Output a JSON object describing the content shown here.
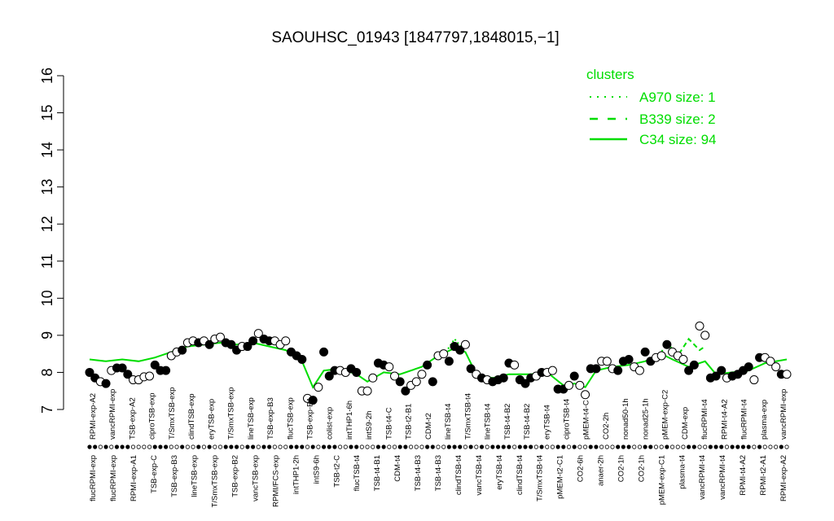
{
  "chart_data": {
    "type": "scatter",
    "title": "SAOUHSC_01943 [1847797,1848015,−1]",
    "ylim": [
      7,
      16
    ],
    "yticks": [
      7,
      8,
      9,
      10,
      11,
      12,
      13,
      14,
      15,
      16
    ],
    "grid": false,
    "legend": {
      "title": "clusters",
      "position": "top-right",
      "entries": [
        {
          "label": "A970 size: 1",
          "style": "dotted"
        },
        {
          "label": "B339 size: 2",
          "style": "dashed"
        },
        {
          "label": "C34 size: 94",
          "style": "solid"
        }
      ]
    },
    "colors": {
      "cluster_line": "#00dd00",
      "point_fill_dark": "#000000",
      "point_fill_light": "#ffffff"
    },
    "bottom_labels": [
      "flucRPMI-exp",
      "flucRPMI-exp",
      "RPMI-exp-A1",
      "TSB-exp-C",
      "TSB-exp-B3",
      "lineTSB-exp",
      "T/SmxTSB-exp",
      "TSB-exp-B2",
      "vancTSB-exp",
      "RPMI/FCS-exp",
      "intTHP1-2h",
      "intS9-6h",
      "TSB-t2-C",
      "flucTSB-t4",
      "TSB-t4-B1",
      "CDM-t4",
      "TSB-t4-B3",
      "TSB-t4-B3",
      "clindTSB-t4",
      "vancTSB-t4",
      "eryTSB-t4",
      "clindTSB-t4",
      "T/SmxTSB-t4",
      "pMEM-t2-C1",
      "CO2-6h",
      "anaer-2h",
      "CO2-1h",
      "CO2-1h",
      "pMEM-exp-C1",
      "plasma-t4",
      "vancRPMI-t4",
      "vancRPMI-t4",
      "RPMI-t4-A2",
      "RPMI-t2-A1",
      "RPMI-exp-A2"
    ],
    "top_labels": [
      "RPMI-exp-A2",
      "vancRPMI-exp",
      "TSB-exp-A2",
      "ciproTSB-exp",
      "T/SmxTSB-exp",
      "clindTSB-exp",
      "eryTSB-exp",
      "T/SmxTSB-exp",
      "lineTSB-exp",
      "TSB-exp-B3",
      "flucTSB-exp",
      "TSB-exp-B1",
      "colist-exp",
      "intTHP1-6h",
      "intS9-2h",
      "TSB-t4-C",
      "TSB-t2-B1",
      "CDM-t2",
      "lineTSB-t4",
      "T/SmxTSB-t4",
      "lineTSB-t4",
      "TSB-t4-B2",
      "TSB-t4-B2",
      "eryTSB-t4",
      "ciproTSB-t4",
      "pMEM-t4-C",
      "CO2-2h",
      "nonad50-1h",
      "nonad25-1h",
      "pMEM-exp-C2",
      "CDM-exp",
      "flucRPMI-t4",
      "RPMI-t4-A2",
      "flucRPMI-t4",
      "plasma-exp",
      "vancRPMI-exp"
    ],
    "points": [
      {
        "x": 1,
        "y": 8.0,
        "f": 1
      },
      {
        "x": 2,
        "y": 7.85,
        "f": 1
      },
      {
        "x": 3,
        "y": 7.75,
        "f": 0
      },
      {
        "x": 4,
        "y": 7.7,
        "f": 1
      },
      {
        "x": 5,
        "y": 8.05,
        "f": 0
      },
      {
        "x": 6,
        "y": 8.12,
        "f": 1
      },
      {
        "x": 7,
        "y": 8.12,
        "f": 1
      },
      {
        "x": 8,
        "y": 7.95,
        "f": 1
      },
      {
        "x": 9,
        "y": 7.8,
        "f": 0
      },
      {
        "x": 10,
        "y": 7.8,
        "f": 0
      },
      {
        "x": 11,
        "y": 7.88,
        "f": 0
      },
      {
        "x": 12,
        "y": 7.9,
        "f": 0
      },
      {
        "x": 13,
        "y": 8.2,
        "f": 1
      },
      {
        "x": 14,
        "y": 8.05,
        "f": 1
      },
      {
        "x": 15,
        "y": 8.05,
        "f": 1
      },
      {
        "x": 16,
        "y": 8.45,
        "f": 0
      },
      {
        "x": 17,
        "y": 8.55,
        "f": 0
      },
      {
        "x": 18,
        "y": 8.6,
        "f": 1
      },
      {
        "x": 19,
        "y": 8.8,
        "f": 0
      },
      {
        "x": 20,
        "y": 8.85,
        "f": 0
      },
      {
        "x": 21,
        "y": 8.8,
        "f": 1
      },
      {
        "x": 22,
        "y": 8.85,
        "f": 0
      },
      {
        "x": 23,
        "y": 8.75,
        "f": 1
      },
      {
        "x": 24,
        "y": 8.9,
        "f": 0
      },
      {
        "x": 25,
        "y": 8.95,
        "f": 0
      },
      {
        "x": 26,
        "y": 8.8,
        "f": 1
      },
      {
        "x": 27,
        "y": 8.75,
        "f": 1
      },
      {
        "x": 28,
        "y": 8.6,
        "f": 1
      },
      {
        "x": 29,
        "y": 8.7,
        "f": 0
      },
      {
        "x": 30,
        "y": 8.7,
        "f": 1
      },
      {
        "x": 31,
        "y": 8.85,
        "f": 1
      },
      {
        "x": 32,
        "y": 9.05,
        "f": 0
      },
      {
        "x": 33,
        "y": 8.9,
        "f": 1
      },
      {
        "x": 34,
        "y": 8.85,
        "f": 1
      },
      {
        "x": 35,
        "y": 8.85,
        "f": 0
      },
      {
        "x": 36,
        "y": 8.75,
        "f": 0
      },
      {
        "x": 37,
        "y": 8.85,
        "f": 0
      },
      {
        "x": 38,
        "y": 8.55,
        "f": 1
      },
      {
        "x": 39,
        "y": 8.45,
        "f": 1
      },
      {
        "x": 40,
        "y": 8.35,
        "f": 1
      },
      {
        "x": 41,
        "y": 7.3,
        "f": 0
      },
      {
        "x": 42,
        "y": 7.25,
        "f": 1
      },
      {
        "x": 43,
        "y": 7.6,
        "f": 0
      },
      {
        "x": 44,
        "y": 8.55,
        "f": 1
      },
      {
        "x": 45,
        "y": 7.9,
        "f": 1
      },
      {
        "x": 46,
        "y": 8.05,
        "f": 1
      },
      {
        "x": 47,
        "y": 8.05,
        "f": 0
      },
      {
        "x": 48,
        "y": 8.0,
        "f": 0
      },
      {
        "x": 49,
        "y": 8.1,
        "f": 1
      },
      {
        "x": 50,
        "y": 8.0,
        "f": 1
      },
      {
        "x": 51,
        "y": 7.5,
        "f": 0
      },
      {
        "x": 52,
        "y": 7.5,
        "f": 0
      },
      {
        "x": 53,
        "y": 7.85,
        "f": 0
      },
      {
        "x": 54,
        "y": 8.25,
        "f": 1
      },
      {
        "x": 55,
        "y": 8.2,
        "f": 1
      },
      {
        "x": 56,
        "y": 8.15,
        "f": 0
      },
      {
        "x": 57,
        "y": 7.9,
        "f": 0
      },
      {
        "x": 58,
        "y": 7.75,
        "f": 1
      },
      {
        "x": 59,
        "y": 7.5,
        "f": 1
      },
      {
        "x": 60,
        "y": 7.65,
        "f": 0
      },
      {
        "x": 61,
        "y": 7.75,
        "f": 0
      },
      {
        "x": 62,
        "y": 7.95,
        "f": 0
      },
      {
        "x": 63,
        "y": 8.2,
        "f": 1
      },
      {
        "x": 64,
        "y": 7.75,
        "f": 1
      },
      {
        "x": 65,
        "y": 8.45,
        "f": 0
      },
      {
        "x": 66,
        "y": 8.5,
        "f": 0
      },
      {
        "x": 67,
        "y": 8.3,
        "f": 1
      },
      {
        "x": 68,
        "y": 8.7,
        "f": 1
      },
      {
        "x": 69,
        "y": 8.6,
        "f": 1
      },
      {
        "x": 70,
        "y": 8.75,
        "f": 0
      },
      {
        "x": 71,
        "y": 8.1,
        "f": 1
      },
      {
        "x": 72,
        "y": 7.95,
        "f": 0
      },
      {
        "x": 73,
        "y": 7.85,
        "f": 1
      },
      {
        "x": 74,
        "y": 7.8,
        "f": 0
      },
      {
        "x": 75,
        "y": 7.75,
        "f": 1
      },
      {
        "x": 76,
        "y": 7.8,
        "f": 1
      },
      {
        "x": 77,
        "y": 7.85,
        "f": 1
      },
      {
        "x": 78,
        "y": 8.25,
        "f": 1
      },
      {
        "x": 79,
        "y": 8.2,
        "f": 0
      },
      {
        "x": 80,
        "y": 7.8,
        "f": 1
      },
      {
        "x": 81,
        "y": 7.7,
        "f": 1
      },
      {
        "x": 82,
        "y": 7.85,
        "f": 1
      },
      {
        "x": 83,
        "y": 7.9,
        "f": 0
      },
      {
        "x": 84,
        "y": 8.0,
        "f": 1
      },
      {
        "x": 85,
        "y": 8.0,
        "f": 0
      },
      {
        "x": 86,
        "y": 8.05,
        "f": 0
      },
      {
        "x": 87,
        "y": 7.55,
        "f": 1
      },
      {
        "x": 88,
        "y": 7.55,
        "f": 1
      },
      {
        "x": 89,
        "y": 7.65,
        "f": 0
      },
      {
        "x": 90,
        "y": 7.9,
        "f": 1
      },
      {
        "x": 91,
        "y": 7.65,
        "f": 0
      },
      {
        "x": 92,
        "y": 7.4,
        "f": 0
      },
      {
        "x": 93,
        "y": 8.1,
        "f": 1
      },
      {
        "x": 94,
        "y": 8.1,
        "f": 1
      },
      {
        "x": 95,
        "y": 8.3,
        "f": 0
      },
      {
        "x": 96,
        "y": 8.3,
        "f": 0
      },
      {
        "x": 97,
        "y": 8.1,
        "f": 0
      },
      {
        "x": 98,
        "y": 8.05,
        "f": 1
      },
      {
        "x": 99,
        "y": 8.3,
        "f": 1
      },
      {
        "x": 100,
        "y": 8.35,
        "f": 1
      },
      {
        "x": 101,
        "y": 8.15,
        "f": 0
      },
      {
        "x": 102,
        "y": 8.05,
        "f": 0
      },
      {
        "x": 103,
        "y": 8.55,
        "f": 1
      },
      {
        "x": 104,
        "y": 8.3,
        "f": 1
      },
      {
        "x": 105,
        "y": 8.4,
        "f": 0
      },
      {
        "x": 106,
        "y": 8.45,
        "f": 0
      },
      {
        "x": 107,
        "y": 8.75,
        "f": 1
      },
      {
        "x": 108,
        "y": 8.55,
        "f": 0
      },
      {
        "x": 109,
        "y": 8.45,
        "f": 0
      },
      {
        "x": 110,
        "y": 8.35,
        "f": 0
      },
      {
        "x": 111,
        "y": 8.05,
        "f": 1
      },
      {
        "x": 112,
        "y": 8.2,
        "f": 1
      },
      {
        "x": 113,
        "y": 9.25,
        "f": 0
      },
      {
        "x": 114,
        "y": 9.0,
        "f": 0
      },
      {
        "x": 115,
        "y": 7.85,
        "f": 1
      },
      {
        "x": 116,
        "y": 7.9,
        "f": 1
      },
      {
        "x": 117,
        "y": 8.05,
        "f": 1
      },
      {
        "x": 118,
        "y": 7.85,
        "f": 0
      },
      {
        "x": 119,
        "y": 7.9,
        "f": 1
      },
      {
        "x": 120,
        "y": 7.95,
        "f": 1
      },
      {
        "x": 121,
        "y": 8.05,
        "f": 1
      },
      {
        "x": 122,
        "y": 8.15,
        "f": 1
      },
      {
        "x": 123,
        "y": 7.8,
        "f": 0
      },
      {
        "x": 124,
        "y": 8.4,
        "f": 1
      },
      {
        "x": 125,
        "y": 8.4,
        "f": 0
      },
      {
        "x": 126,
        "y": 8.3,
        "f": 0
      },
      {
        "x": 127,
        "y": 8.15,
        "f": 0
      },
      {
        "x": 128,
        "y": 7.95,
        "f": 1
      },
      {
        "x": 129,
        "y": 7.95,
        "f": 0
      }
    ],
    "line_solid": [
      [
        1,
        8.35
      ],
      [
        4,
        8.3
      ],
      [
        7,
        8.35
      ],
      [
        10,
        8.3
      ],
      [
        13,
        8.4
      ],
      [
        16,
        8.55
      ],
      [
        19,
        8.7
      ],
      [
        22,
        8.75
      ],
      [
        25,
        8.8
      ],
      [
        28,
        8.75
      ],
      [
        31,
        8.8
      ],
      [
        34,
        8.7
      ],
      [
        37,
        8.6
      ],
      [
        40,
        8.3
      ],
      [
        42,
        7.6
      ],
      [
        44,
        8.05
      ],
      [
        47,
        8.1
      ],
      [
        50,
        7.95
      ],
      [
        52,
        7.75
      ],
      [
        55,
        8.0
      ],
      [
        58,
        7.95
      ],
      [
        62,
        8.15
      ],
      [
        65,
        8.45
      ],
      [
        68,
        8.65
      ],
      [
        70,
        8.55
      ],
      [
        72,
        7.95
      ],
      [
        75,
        7.85
      ],
      [
        78,
        7.95
      ],
      [
        82,
        7.95
      ],
      [
        85,
        8.0
      ],
      [
        88,
        7.65
      ],
      [
        90,
        7.7
      ],
      [
        92,
        7.6
      ],
      [
        94,
        8.05
      ],
      [
        97,
        8.15
      ],
      [
        100,
        8.2
      ],
      [
        103,
        8.3
      ],
      [
        106,
        8.5
      ],
      [
        108,
        8.35
      ],
      [
        111,
        8.15
      ],
      [
        114,
        8.3
      ],
      [
        116,
        7.95
      ],
      [
        119,
        8.0
      ],
      [
        122,
        8.05
      ],
      [
        125,
        8.25
      ],
      [
        129,
        8.35
      ]
    ],
    "line_dashed": [
      [
        105,
        8.3
      ],
      [
        107,
        8.8
      ],
      [
        109,
        8.45
      ],
      [
        111,
        8.9
      ],
      [
        113,
        8.6
      ],
      [
        114,
        8.7
      ]
    ],
    "line_dotted": [
      [
        66,
        8.45
      ],
      [
        68,
        8.9
      ],
      [
        70,
        8.55
      ]
    ]
  }
}
